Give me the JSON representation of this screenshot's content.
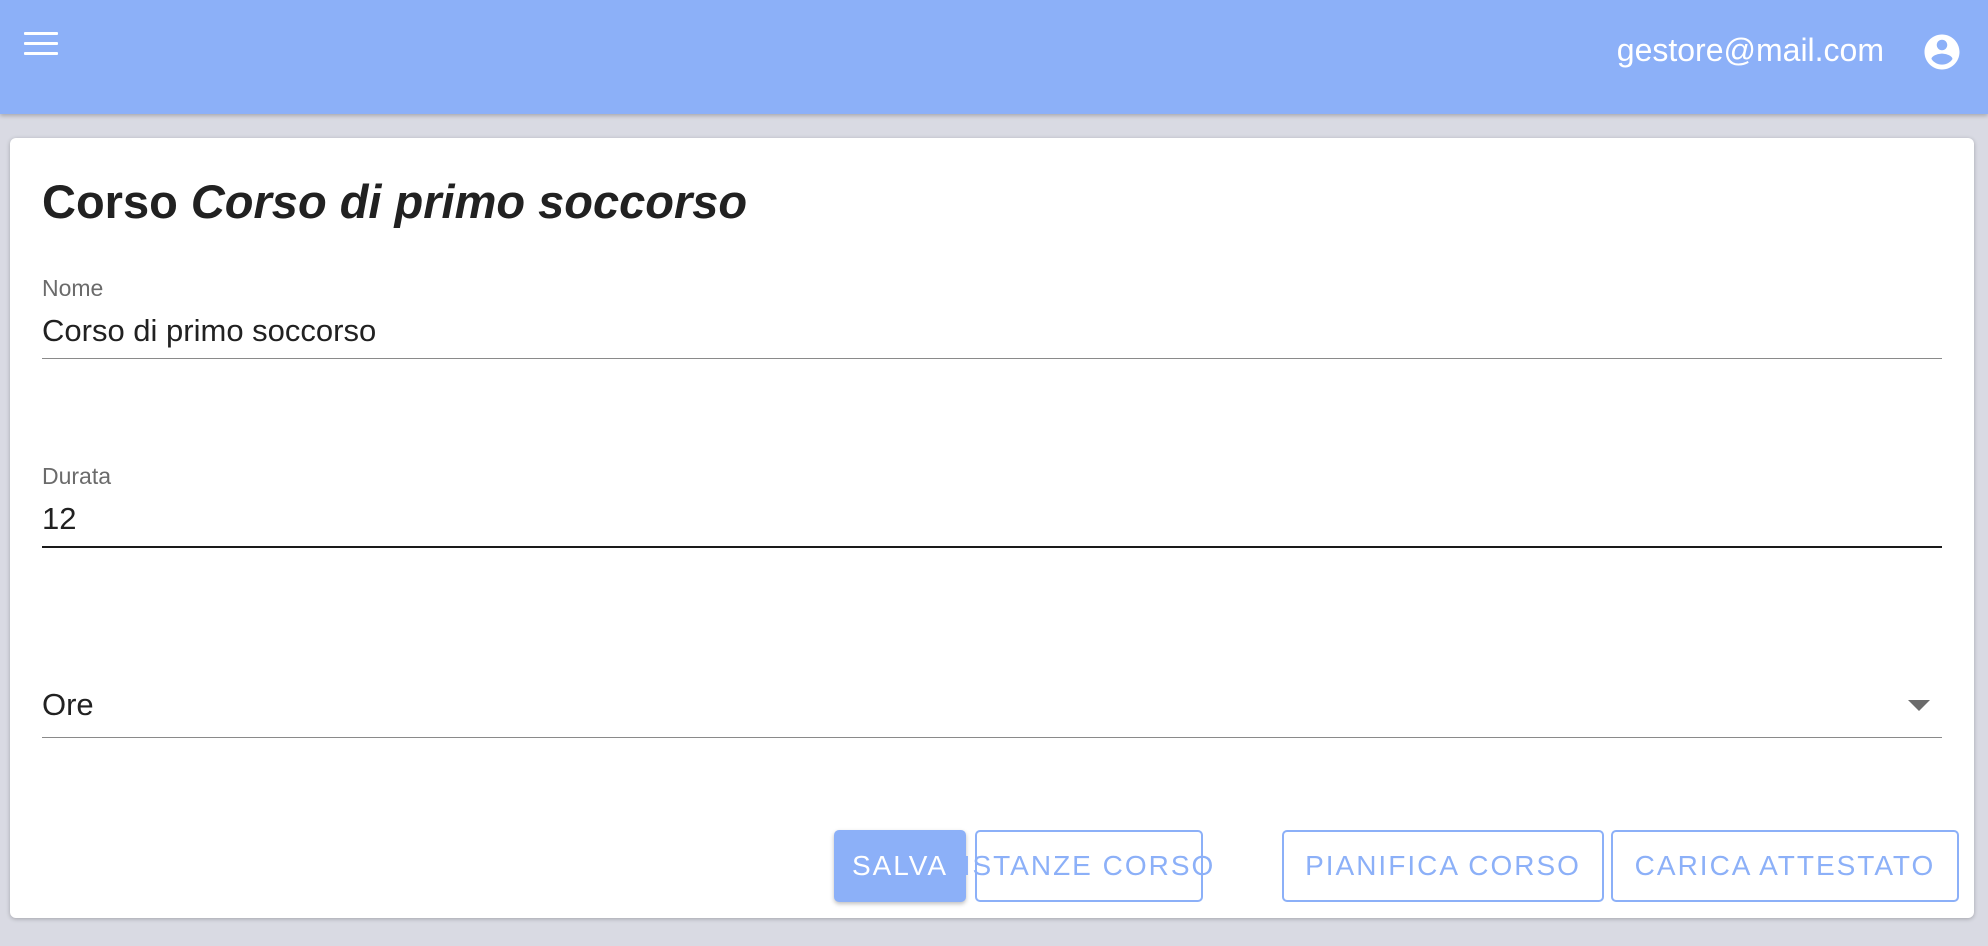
{
  "header": {
    "menu_icon": "hamburger-menu-icon",
    "user_email": "gestore@mail.com",
    "account_icon": "account-circle-icon",
    "background_color": "#8cb0f8"
  },
  "page": {
    "title_prefix": "Corso",
    "title_name": "Corso di primo soccorso"
  },
  "form": {
    "nome": {
      "label": "Nome",
      "value": "Corso di primo soccorso"
    },
    "durata": {
      "label": "Durata",
      "value": "12"
    },
    "unita": {
      "selected": "Ore",
      "arrow_icon": "dropdown-arrow-icon"
    }
  },
  "actions": {
    "salva": "Salva",
    "istanze_corso": "Istanze corso",
    "pianifica_corso": "Pianifica corso",
    "carica_attestato": "Carica attestato"
  },
  "colors": {
    "accent": "#8cb0f8",
    "page_background": "#d9dae3",
    "text": "#212121"
  }
}
